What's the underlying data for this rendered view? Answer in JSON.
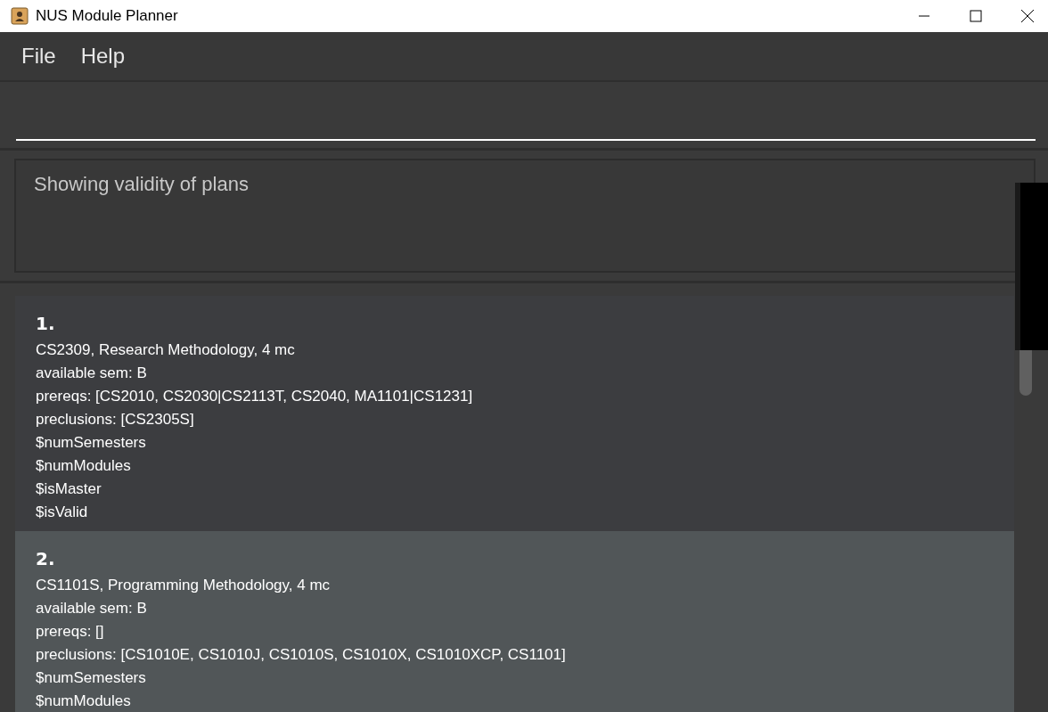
{
  "window": {
    "title": "NUS Module Planner"
  },
  "menu": [
    "File",
    "Help"
  ],
  "result_box": {
    "text": "Showing validity of plans"
  },
  "modules": [
    {
      "index": "1.",
      "selected": false,
      "lines": [
        "CS2309, Research Methodology, 4 mc",
        "available sem: B",
        "prereqs: [CS2010, CS2030|CS2113T, CS2040, MA1101|CS1231]",
        "preclusions: [CS2305S]",
        "$numSemesters",
        "$numModules",
        "$isMaster",
        "$isValid"
      ]
    },
    {
      "index": "2.",
      "selected": true,
      "lines": [
        "CS1101S, Programming Methodology, 4 mc",
        "available sem: B",
        "prereqs: []",
        "preclusions: [CS1010E, CS1010J, CS1010S, CS1010X, CS1010XCP, CS1101]",
        "$numSemesters",
        "$numModules"
      ]
    }
  ]
}
